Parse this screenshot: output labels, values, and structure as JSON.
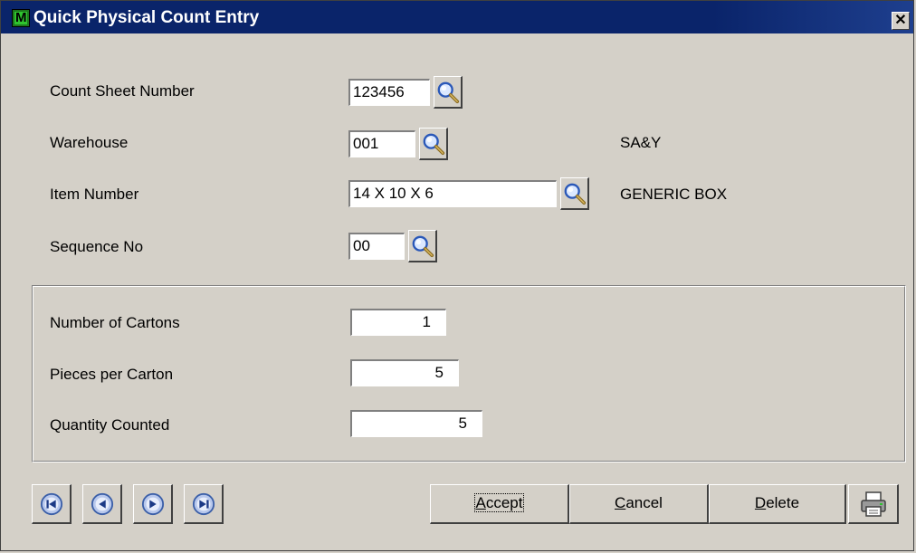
{
  "window": {
    "title": "Quick Physical Count Entry",
    "app_icon_letter": "M",
    "close_label": "✕"
  },
  "header_fields": {
    "count_sheet_number": {
      "label": "Count Sheet Number",
      "value": "123456"
    },
    "warehouse": {
      "label": "Warehouse",
      "value": "001",
      "description": "SA&Y"
    },
    "item_number": {
      "label": "Item Number",
      "value": "14 X 10 X 6",
      "description": "GENERIC BOX"
    },
    "sequence_no": {
      "label": "Sequence No",
      "value": "00"
    }
  },
  "count_fields": {
    "number_of_cartons": {
      "label": "Number of Cartons",
      "value": "1"
    },
    "pieces_per_carton": {
      "label": "Pieces per Carton",
      "value": "5"
    },
    "quantity_counted": {
      "label": "Quantity Counted",
      "value": "5"
    }
  },
  "buttons": {
    "accept": {
      "accel": "A",
      "rest": "ccept"
    },
    "cancel": {
      "accel": "C",
      "rest": "ancel"
    },
    "delete": {
      "accel": "D",
      "rest": "elete"
    }
  },
  "icons": {
    "lookup": "magnifier-icon",
    "nav_first": "first-record-icon",
    "nav_prev": "previous-record-icon",
    "nav_next": "next-record-icon",
    "nav_last": "last-record-icon",
    "print": "printer-icon"
  },
  "colors": {
    "titlebar": "#0a246a",
    "face": "#d4d0c8",
    "nav_icon": "#3b5fa8"
  }
}
